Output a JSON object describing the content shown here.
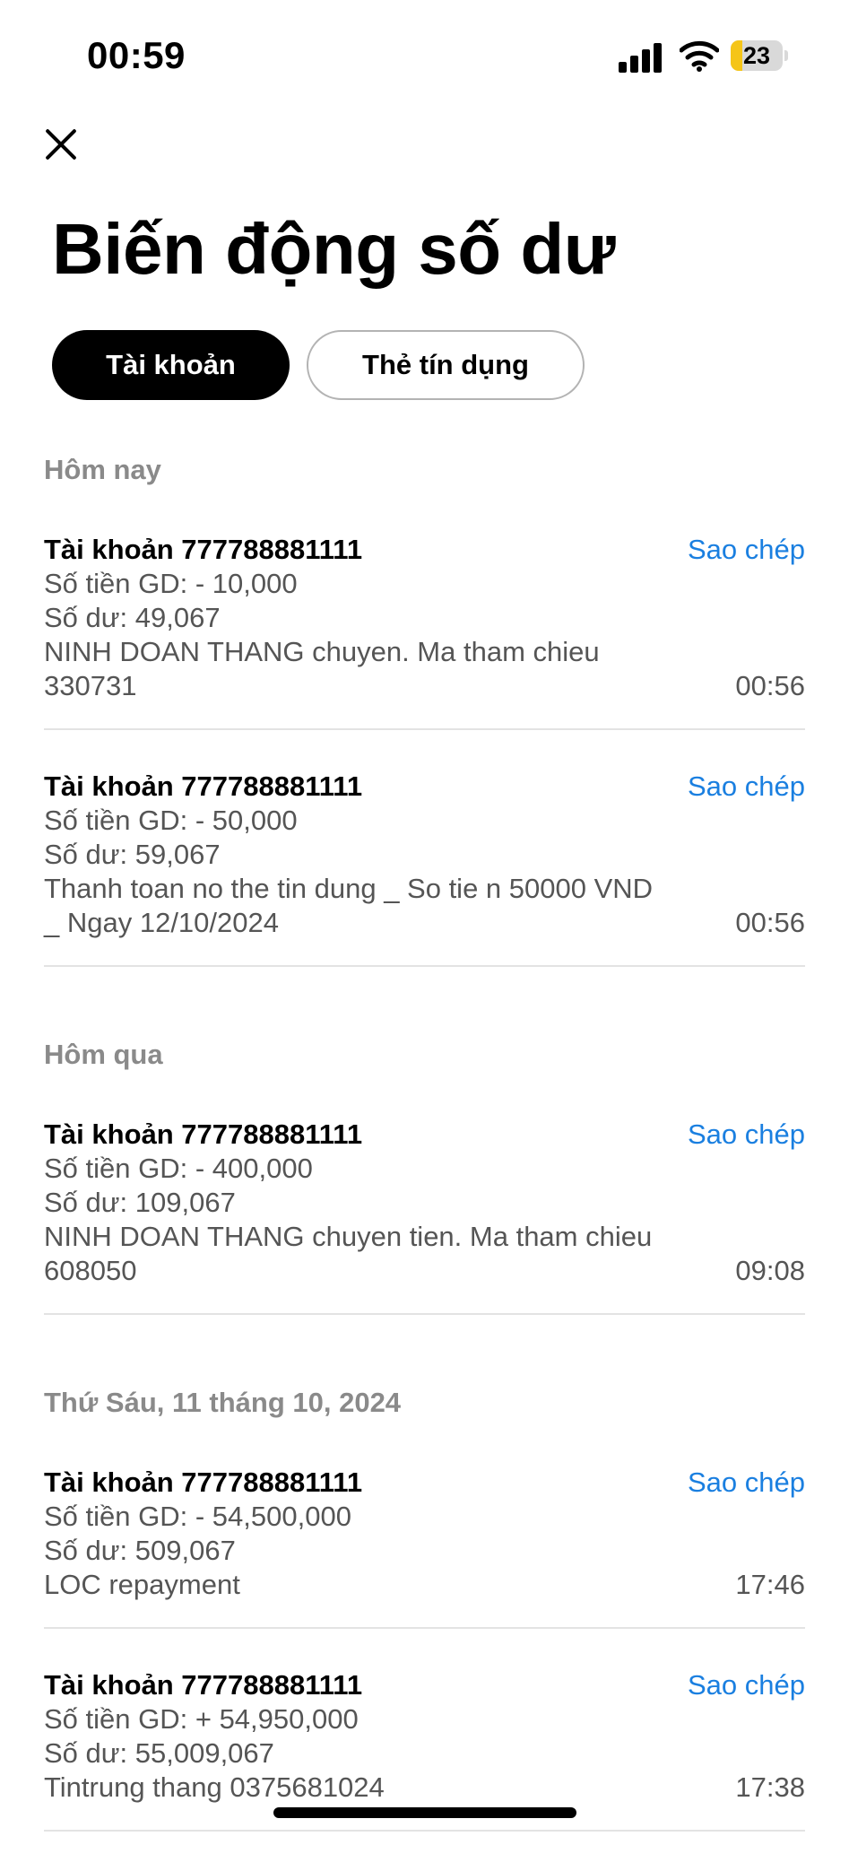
{
  "status_bar": {
    "time": "00:59",
    "battery": "23"
  },
  "page": {
    "title": "Biến động số dư"
  },
  "tabs": [
    {
      "label": "Tài khoản",
      "active": true
    },
    {
      "label": "Thẻ tín dụng",
      "active": false
    }
  ],
  "copy_label": "Sao chép",
  "sections": [
    {
      "title": "Hôm nay",
      "items": [
        {
          "account": "Tài khoản 777788881111",
          "amount": "Số tiền GD: - 10,000",
          "balance": "Số dư:  49,067",
          "description": "NINH DOAN THANG chuyen. Ma tham chieu 330731",
          "time": "00:56"
        },
        {
          "account": "Tài khoản 777788881111",
          "amount": "Số tiền GD: - 50,000",
          "balance": "Số dư:  59,067",
          "description": "Thanh toan no the tin dung _ So tie n 50000 VND _ Ngay 12/10/2024",
          "time": "00:56"
        }
      ]
    },
    {
      "title": "Hôm qua",
      "items": [
        {
          "account": "Tài khoản 777788881111",
          "amount": "Số tiền GD: - 400,000",
          "balance": "Số dư:  109,067",
          "description": "NINH DOAN THANG chuyen tien. Ma tham chieu 608050",
          "time": "09:08"
        }
      ]
    },
    {
      "title": "Thứ Sáu, 11 tháng 10, 2024",
      "items": [
        {
          "account": "Tài khoản 777788881111",
          "amount": "Số tiền GD: - 54,500,000",
          "balance": "Số dư:  509,067",
          "description": "LOC repayment",
          "time": "17:46"
        },
        {
          "account": "Tài khoản 777788881111",
          "amount": "Số tiền GD: + 54,950,000",
          "balance": "Số dư:  55,009,067",
          "description": "Tintrung thang 0375681024",
          "time": "17:38"
        }
      ]
    }
  ],
  "colors": {
    "accent": "#1a7fe0",
    "battery": "#f5c518",
    "muted": "#8a8a8a"
  }
}
